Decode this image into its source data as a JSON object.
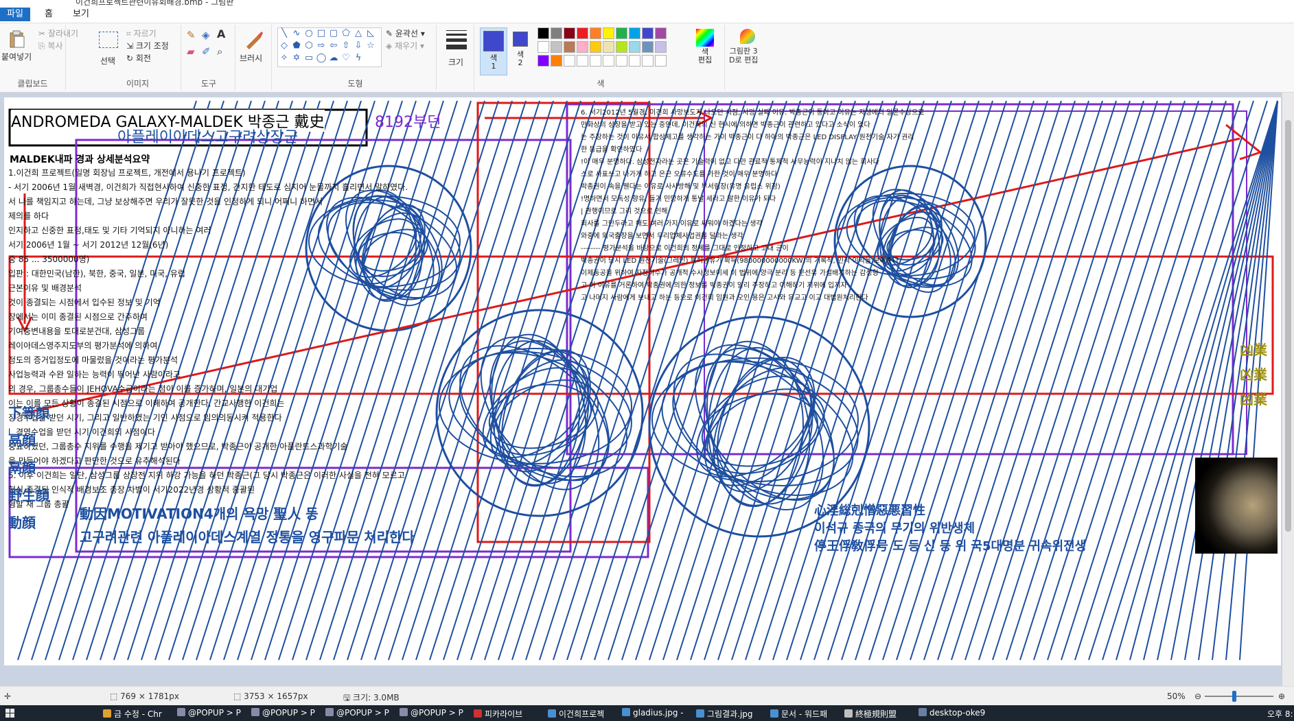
{
  "window": {
    "title": "이건희프로젝트관련이유회배경.bmp - 그림판"
  },
  "tabs": {
    "file": "파일",
    "home": "홈",
    "view": "보기"
  },
  "ribbon": {
    "clipboard": {
      "paste": "붙여넣기",
      "cut": "잘라내기",
      "copy": "복사",
      "label": "클립보드"
    },
    "image": {
      "select": "선택",
      "crop": "자르기",
      "resize": "크기 조정",
      "rotate": "회전",
      "label": "이미지"
    },
    "tools": {
      "label": "도구"
    },
    "brushes": {
      "label": "브러시"
    },
    "shapes": {
      "outline": "윤곽선",
      "fill": "채우기",
      "label": "도형"
    },
    "size": {
      "label": "크기"
    },
    "colors": {
      "color1": "색\n1",
      "color2": "색\n2",
      "edit": "색\n편집",
      "label": "색",
      "palette": [
        "#000000",
        "#7f7f7f",
        "#880015",
        "#ed1c24",
        "#ff7f27",
        "#fff200",
        "#22b14c",
        "#00a2e8",
        "#3f48cc",
        "#a349a4",
        "#ffffff",
        "#c3c3c3",
        "#b97a57",
        "#ffaec9",
        "#ffc90e",
        "#efe4b0",
        "#b5e61d",
        "#99d9ea",
        "#7092be",
        "#c8bfe7",
        "#8000ff",
        "#ff8000",
        "#ffffff",
        "#ffffff",
        "#ffffff",
        "#ffffff",
        "#ffffff",
        "#ffffff",
        "#ffffff",
        "#ffffff"
      ],
      "primary": "#3f48cc",
      "secondary": "#3f48cc"
    },
    "paint3d": {
      "label": "그림판 3\nD로 편집"
    }
  },
  "canvas": {
    "header_box": "ANDROMEDA GALAXY-MALDEK 박종근 戴史",
    "header_num": "8192부던",
    "header_sub": "아플레이아데스고구려상장군",
    "section_title": "MALDEK내파 경과 상세분석요약",
    "lines": [
      "1.이건희 프로젝트(일명 회장님 프로젝트, 개전에서 용나기 프로젝트)",
      "- 서기 2006년 1월 새벽경, 이건희가 직접현시하여 신중한 표정, 간지한 태도로 심지어 눈물까지 흘리면서 말하였다.",
      "서 나를 책임지고 하는데, 그냥 보상해주면 우리가 잘못한 것을 인정하게 되니 어쩌니 하면서",
      "제의를 하다",
      "인지하고 신중한 표정,태도 및 기타 기억되지 아니하는 여러",
      "서기 2006년 1월 ~ 서기 2012년 12월(6년)",
      "중 85 ... 3500000명)",
      "입판 : 대한민국(남한), 북한, 중국, 일본, 미국, 유럽",
      "근본이유 및 배경분석",
      "것이 종결되는 시점에서 입수된 정보 및 기억",
      "장에서는 이미 종결된 시점으로 간주하여",
      "기여충변내용을 토대로분건대, 삼성그룹",
      "레이아데스영주지도부의 평가분석에 의하여",
      "정도의 증거입정도에 마물렀을 것이라는 평가분석",
      "사업능력과 수완 일하는 능력이 뛰어난 사람이라고",
      "의 경우, 그룹총수들이 JEHOVA수급이라는 점이 이를 증가하며, 일본의 대기업",
      "이는 이를 모든 상황이 종결된 시점으로 이해하여 공개한다, 간교사행한 이건희는",
      "장경수업을 받던 시기, 그리고 일반하였는 기인 시점으로 임의의동시켜 적용한다",
      "l. 경영수업을 받던 시기 이건희의 시점이다",
      "중요하였던, 그룹총수 지위를 수행을 제기고 받아야 했으므로, 박종근이 공개한 아플란트스과학기술",
      "을 만들어야 하겠다고 판단한 것으로 유추해석된다",
      "5. 이후 이건희는 일단, 삼성그룹 상장전 지위 하강 가능을 하던 박종근(그 당시 박종근은 이러한 사실을 전혀 모르고",
      "현실 종결된 인식적 배경보조 총장 차별이 서기2022년경 상황적 종괄된",
      "형할 채 그룹 총괄"
    ],
    "right_lines": [
      "6. 서기2012년 5월경, 이건희 사망보도가 나오던 시점, 사망 실패 이유: 박종근이 통아고 이유는 자생에의 일론수상으로",
      "만화상의 상장을 받고 있는 중인데, 이건희의 신 현시에 의하면 박종근이 관련하고 있다고 소식이 있다",
      "는 주장하는 것이 이유서 합상제고를 생각하는 가이 박종근이 다 하아의 박종근은 LED DISPLAY 원천기술 자기 권리",
      "한 등급을 확인하였다",
      "!이 매우 분명하다. 삼성전자라는 곳은 기술력이 없고 다만 관료적 통제적 사무능력이 지나치 않는 회사다",
      "스로 사표쓰고 나가게 하고 은근 오류수도를 가한 것이 매우 분명하다",
      "박종권이 속을 웬다는 이유로 사사방해 및 부서림장(유명 유럽스 위정)",
      "!명하면서 모독성 향유, 들기 민망하게 통날 세라고 말한 이유가 되다",
      "| 관행이므로 그리 것으로 인해",
      "회사를 그만두라고 해도 여러 가지 이유로 싸워야 하겠다는 생각",
      "와중에 외국출장을 보면서 우리업체사업권을 달라는 생각",
      "-------- 평가분석을 바탕으로 이건희의 정체를 그대로 인정하고 고대 군이",
      "박종권이 당시 LED 원천기술(그레인) 특허공유기 확득(980000000000KW)의 기록적, 인적 이익을 보여준다",
      "이제동공을 위하여 자정하수가 공개적 수사정보이세 이 법위에 양극 분리 등 문선유 가설배치하는 감성형",
      "고 이 이유를 거론하여 박종권에 의한 정보를 박종권이 알리 주장하고 이해하기 지위에 입지자",
      "고 나머지 사람에게 보내고 하는 등으로 이건희 임원과 오인 용은 고시와 유교고 이고 대법원처리한다"
    ],
    "bottom_left_labels": [
      "下等顔",
      "鬲顔",
      "鬲顔",
      "野生顔",
      "動顔"
    ],
    "bottom_lines": [
      "動因MOTIVATION4개의 욕망 聖人 등",
      "고구려관련 아플레이아데스계열 정통을 영구파문 처리한다"
    ],
    "bottom_right_lines": [
      "心淫総剋憎惡悪習性",
      "이석규 종극의 무기의 위반생체",
      "停王俘敎俘号 도 등 신 등 위 국5대명분 귀속위전생"
    ],
    "right_tags": [
      "凶業",
      "凶業",
      "凶業"
    ]
  },
  "statusbar": {
    "selection_size": "769 × 1781px",
    "image_size": "3753 × 1657px",
    "file_size": "크기: 3.0MB",
    "zoom": "50%",
    "zoom_level": 0.5
  },
  "taskbar": {
    "items": [
      {
        "label": "금 수정 - Chr",
        "color": "#e0a030"
      },
      {
        "label": "@POPUP > P",
        "color": "#8a8aa8"
      },
      {
        "label": "@POPUP > P",
        "color": "#8a8aa8"
      },
      {
        "label": "@POPUP > P",
        "color": "#8a8aa8"
      },
      {
        "label": "@POPUP > P",
        "color": "#8a8aa8"
      },
      {
        "label": "피카라이브",
        "color": "#d03030"
      },
      {
        "label": "이건희프로젝",
        "color": "#4a8fd0"
      },
      {
        "label": "gladius.jpg -",
        "color": "#4a8fd0"
      },
      {
        "label": "그림결과.jpg",
        "color": "#4a8fd0"
      },
      {
        "label": "문서 - 워드패",
        "color": "#4a8fd0"
      },
      {
        "label": "終極規則盟",
        "color": "#c0c0c0"
      },
      {
        "label": "desktop-oke9",
        "color": "#6a7fa0"
      }
    ],
    "clock": "오후 8:1"
  }
}
